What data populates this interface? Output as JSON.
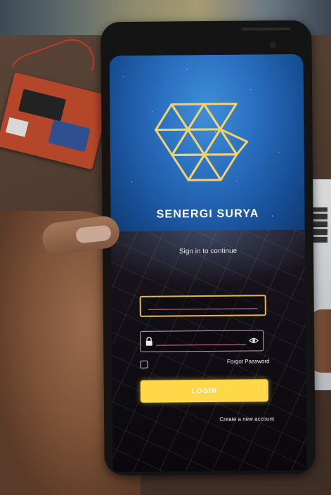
{
  "app": {
    "brand_name": "SENERGI SURYA",
    "subtitle": "Sign in to continue",
    "accent_color": "#ffd84a",
    "logo_icon": "geometric-s-logo-icon"
  },
  "form": {
    "email": {
      "value": "",
      "placeholder": ""
    },
    "password": {
      "value": "",
      "placeholder": "",
      "icon_left": "lock-icon",
      "icon_right": "eye-icon"
    },
    "remember_checked": false,
    "forgot_password_label": "Forgot Password",
    "login_label": "LOGIN",
    "create_account_label": "Create a new account"
  }
}
